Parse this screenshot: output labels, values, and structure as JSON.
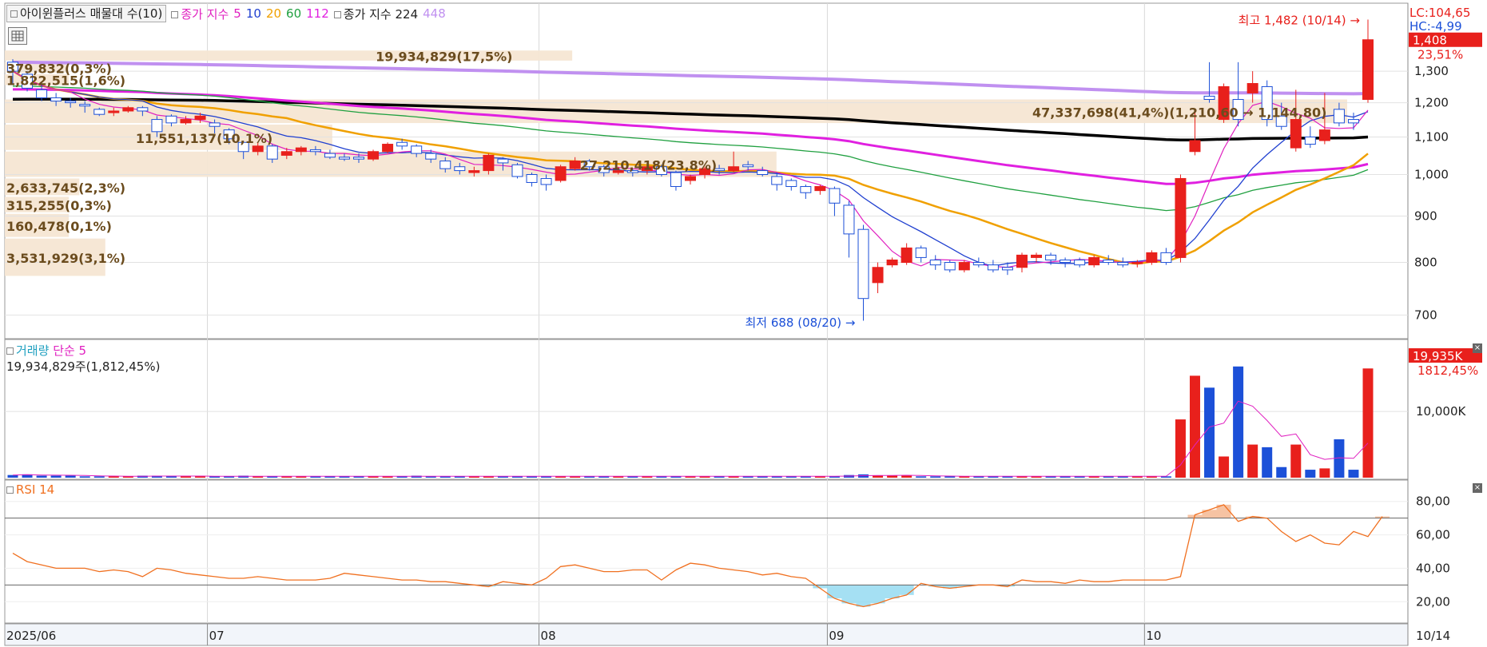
{
  "legend": {
    "vp_label": "아이윈플러스 매물대 수(10)",
    "ma_label": "종가 지수",
    "ma_periods": [
      "5",
      "10",
      "20",
      "60",
      "112"
    ],
    "ma_colors": [
      "#e020c0",
      "#2040d0",
      "#f0a000",
      "#20a040",
      "#e020e0"
    ],
    "long_label": "종가 지수 224",
    "long_extra": "448",
    "long_color": "#000000",
    "extra_color": "#c090f0"
  },
  "info": {
    "lc": "LC:104,65",
    "hc": "HC:-4,99",
    "current_price": "1,408",
    "current_pct": "23,51%"
  },
  "annotations": {
    "high": "최고 1,482 (10/14) →",
    "low": "최저 688 (08/20) →",
    "range_label": "47,337,698(41,4%)(1,210,60 → 1,144,80)"
  },
  "volume_profile": [
    {
      "label": "19,934,829(17,5%)",
      "price_lo": 1330,
      "price_hi": 1370,
      "pct": 17.5
    },
    {
      "label": "379,832(0,3%)",
      "price_lo": 1290,
      "price_hi": 1330,
      "pct": 0.3
    },
    {
      "label": "1,822,515(1,6%)",
      "price_lo": 1250,
      "price_hi": 1290,
      "pct": 1.6
    },
    {
      "label": "47,337,698(41,4%)",
      "price_lo": 1135,
      "price_hi": 1210,
      "pct": 41.4
    },
    {
      "label": "11,551,137(10,1%)",
      "price_lo": 1060,
      "price_hi": 1135,
      "pct": 10.1
    },
    {
      "label": "27,210,418(23,8%)",
      "price_lo": 990,
      "price_hi": 1060,
      "pct": 23.8
    },
    {
      "label": "2,633,745(2,3%)",
      "price_lo": 945,
      "price_hi": 990,
      "pct": 2.3
    },
    {
      "label": "315,255(0,3%)",
      "price_lo": 905,
      "price_hi": 945,
      "pct": 0.3
    },
    {
      "label": "160,478(0,1%)",
      "price_lo": 850,
      "price_hi": 905,
      "pct": 0.1
    },
    {
      "label": "3,531,929(3,1%)",
      "price_lo": 770,
      "price_hi": 850,
      "pct": 3.1
    }
  ],
  "volume_panel": {
    "title": "거래량",
    "ma_label": "단순 5",
    "summary": "19,934,829주(1,812,45%)",
    "current": "19,935K",
    "current_pct": "1812,45%",
    "axis_label": "10,000K"
  },
  "rsi_panel": {
    "title": "RSI 14",
    "overbought": 70,
    "oversold": 30
  },
  "x_axis": {
    "labels": [
      "2025/06",
      "07",
      "08",
      "09",
      "10"
    ],
    "right_label": "10/14"
  },
  "chart_data": {
    "type": "candlestick",
    "y_ticks": [
      "1,300",
      "1,200",
      "1,100",
      "1,000",
      "900",
      "800",
      "700"
    ],
    "y_log": true,
    "high_marker": {
      "value": 1482,
      "date": "10/14"
    },
    "low_marker": {
      "value": 688,
      "date": "08/20"
    },
    "candles": [
      [
        1330,
        1300,
        1340,
        1260
      ],
      [
        1290,
        1245,
        1300,
        1235
      ],
      [
        1240,
        1215,
        1260,
        1205
      ],
      [
        1215,
        1205,
        1230,
        1190
      ],
      [
        1205,
        1200,
        1215,
        1185
      ],
      [
        1195,
        1190,
        1205,
        1170
      ],
      [
        1180,
        1165,
        1185,
        1160
      ],
      [
        1170,
        1175,
        1185,
        1160
      ],
      [
        1175,
        1185,
        1190,
        1170
      ],
      [
        1185,
        1175,
        1190,
        1160
      ],
      [
        1150,
        1115,
        1160,
        1100
      ],
      [
        1160,
        1140,
        1165,
        1130
      ],
      [
        1140,
        1150,
        1160,
        1135
      ],
      [
        1150,
        1160,
        1170,
        1140
      ],
      [
        1140,
        1130,
        1150,
        1110
      ],
      [
        1120,
        1095,
        1125,
        1080
      ],
      [
        1085,
        1060,
        1090,
        1040
      ],
      [
        1060,
        1075,
        1085,
        1050
      ],
      [
        1075,
        1040,
        1080,
        1030
      ],
      [
        1050,
        1060,
        1070,
        1040
      ],
      [
        1060,
        1070,
        1075,
        1050
      ],
      [
        1065,
        1060,
        1075,
        1050
      ],
      [
        1055,
        1045,
        1065,
        1040
      ],
      [
        1045,
        1040,
        1055,
        1035
      ],
      [
        1045,
        1040,
        1055,
        1030
      ],
      [
        1040,
        1060,
        1065,
        1035
      ],
      [
        1060,
        1080,
        1085,
        1055
      ],
      [
        1085,
        1075,
        1095,
        1065
      ],
      [
        1075,
        1055,
        1080,
        1045
      ],
      [
        1055,
        1040,
        1065,
        1030
      ],
      [
        1035,
        1015,
        1045,
        1005
      ],
      [
        1020,
        1010,
        1030,
        1000
      ],
      [
        1005,
        1010,
        1020,
        995
      ],
      [
        1010,
        1050,
        1055,
        1000
      ],
      [
        1040,
        1030,
        1045,
        1010
      ],
      [
        1025,
        995,
        1030,
        990
      ],
      [
        1000,
        980,
        1005,
        970
      ],
      [
        990,
        975,
        1000,
        960
      ],
      [
        985,
        1020,
        1025,
        980
      ],
      [
        1015,
        1035,
        1045,
        1010
      ],
      [
        1035,
        1020,
        1040,
        1010
      ],
      [
        1020,
        1005,
        1025,
        995
      ],
      [
        1005,
        1010,
        1020,
        1000
      ],
      [
        1010,
        1005,
        1015,
        995
      ],
      [
        1010,
        1020,
        1025,
        1000
      ],
      [
        1020,
        1000,
        1025,
        995
      ],
      [
        1005,
        970,
        1010,
        960
      ],
      [
        985,
        995,
        1000,
        975
      ],
      [
        1000,
        1015,
        1020,
        990
      ],
      [
        1015,
        1010,
        1025,
        1000
      ],
      [
        1010,
        1020,
        1060,
        1005
      ],
      [
        1025,
        1020,
        1035,
        1010
      ],
      [
        1010,
        1000,
        1020,
        995
      ],
      [
        995,
        975,
        1005,
        960
      ],
      [
        985,
        970,
        990,
        960
      ],
      [
        970,
        955,
        975,
        940
      ],
      [
        960,
        970,
        975,
        950
      ],
      [
        965,
        930,
        970,
        900
      ],
      [
        925,
        860,
        935,
        810
      ],
      [
        870,
        730,
        880,
        690
      ],
      [
        760,
        790,
        800,
        740
      ],
      [
        795,
        805,
        810,
        790
      ],
      [
        800,
        830,
        840,
        795
      ],
      [
        830,
        810,
        835,
        800
      ],
      [
        805,
        795,
        815,
        785
      ],
      [
        800,
        785,
        805,
        780
      ],
      [
        785,
        800,
        805,
        780
      ],
      [
        800,
        795,
        810,
        790
      ],
      [
        795,
        785,
        805,
        780
      ],
      [
        790,
        785,
        800,
        775
      ],
      [
        790,
        815,
        820,
        780
      ],
      [
        810,
        815,
        820,
        800
      ],
      [
        815,
        805,
        820,
        795
      ],
      [
        805,
        800,
        810,
        790
      ],
      [
        805,
        795,
        810,
        790
      ],
      [
        795,
        810,
        815,
        790
      ],
      [
        805,
        800,
        815,
        795
      ],
      [
        800,
        795,
        810,
        790
      ],
      [
        800,
        800,
        805,
        790
      ],
      [
        800,
        820,
        825,
        795
      ],
      [
        820,
        800,
        830,
        795
      ],
      [
        810,
        990,
        1000,
        800
      ],
      [
        1060,
        1090,
        1180,
        1050
      ],
      [
        1220,
        1210,
        1330,
        1200
      ],
      [
        1150,
        1250,
        1260,
        1140
      ],
      [
        1210,
        1150,
        1330,
        1130
      ],
      [
        1230,
        1260,
        1300,
        1200
      ],
      [
        1250,
        1150,
        1270,
        1130
      ],
      [
        1160,
        1130,
        1200,
        1120
      ],
      [
        1070,
        1150,
        1240,
        1060
      ],
      [
        1100,
        1080,
        1130,
        1070
      ],
      [
        1090,
        1120,
        1230,
        1080
      ],
      [
        1180,
        1140,
        1200,
        1130
      ],
      [
        1150,
        1140,
        1170,
        1120
      ],
      [
        1210,
        1408,
        1482,
        1200
      ]
    ],
    "volumes": [
      0.4,
      0.5,
      0.3,
      0.3,
      0.3,
      0.2,
      0.2,
      0.2,
      0.2,
      0.3,
      0.3,
      0.2,
      0.2,
      0.2,
      0.2,
      0.2,
      0.3,
      0.2,
      0.2,
      0.2,
      0.2,
      0.2,
      0.2,
      0.2,
      0.2,
      0.2,
      0.2,
      0.2,
      0.3,
      0.2,
      0.2,
      0.2,
      0.2,
      0.2,
      0.2,
      0.2,
      0.2,
      0.2,
      0.2,
      0.2,
      0.2,
      0.2,
      0.2,
      0.2,
      0.2,
      0.2,
      0.2,
      0.2,
      0.2,
      0.2,
      0.2,
      0.2,
      0.2,
      0.2,
      0.2,
      0.2,
      0.2,
      0.2,
      0.4,
      0.5,
      0.3,
      0.3,
      0.3,
      0.2,
      0.2,
      0.2,
      0.2,
      0.2,
      0.2,
      0.2,
      0.2,
      0.2,
      0.2,
      0.2,
      0.2,
      0.2,
      0.2,
      0.2,
      0.2,
      0.2,
      0.2,
      8.8,
      15.4,
      13.6,
      3.2,
      16.8,
      5.0,
      4.6,
      1.6,
      5.0,
      1.2,
      1.4,
      5.8,
      1.2,
      16.5
    ],
    "rsi": [
      49,
      44,
      42,
      40,
      40,
      40,
      38,
      39,
      38,
      35,
      40,
      39,
      37,
      36,
      35,
      34,
      34,
      35,
      34,
      33,
      33,
      33,
      34,
      37,
      36,
      35,
      34,
      33,
      33,
      32,
      32,
      31,
      30,
      29,
      32,
      31,
      30,
      34,
      41,
      42,
      40,
      38,
      38,
      39,
      39,
      33,
      39,
      43,
      42,
      40,
      39,
      38,
      36,
      37,
      35,
      34,
      28,
      22,
      19,
      17,
      19,
      22,
      24,
      31,
      29,
      28,
      29,
      30,
      30,
      29,
      33,
      32,
      32,
      31,
      33,
      32,
      32,
      33,
      33,
      33,
      33,
      35,
      72,
      75,
      78,
      68,
      71,
      70,
      62,
      56,
      60,
      55,
      54,
      62,
      59,
      71
    ],
    "rsi_ticks": [
      "80,00",
      "60,00",
      "40,00",
      "20,00"
    ]
  }
}
